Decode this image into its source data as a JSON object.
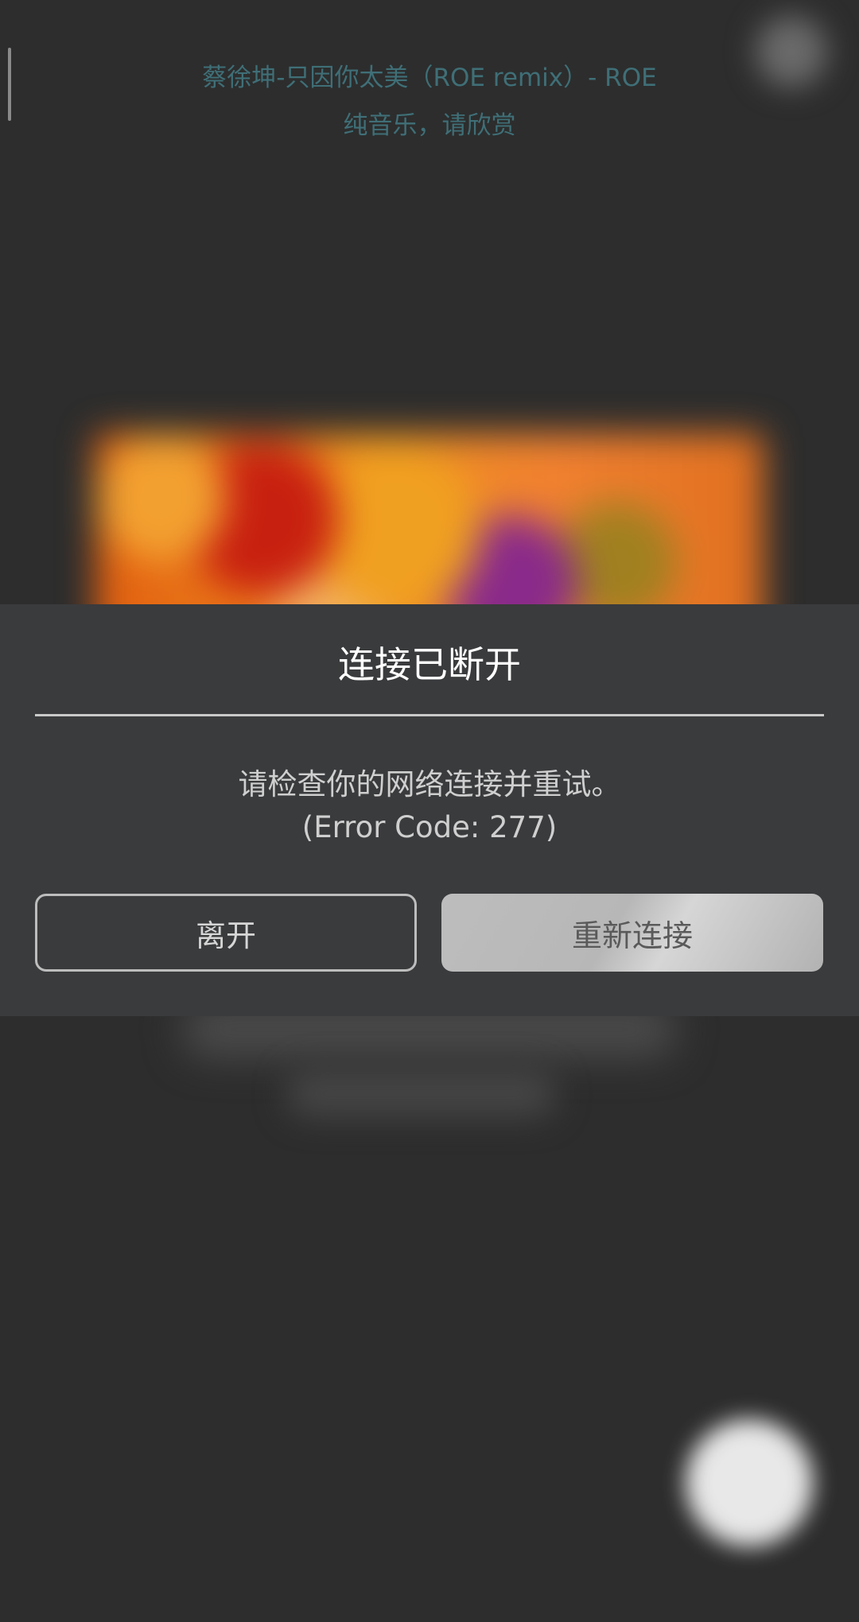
{
  "now_playing": {
    "title": "蔡徐坤-只因你太美（ROE remix）- ROE",
    "subtitle": "纯音乐，请欣赏"
  },
  "dialog": {
    "title": "连接已断开",
    "message_line1": "请检查你的网络连接并重试。",
    "message_line2": "(Error Code: 277)",
    "leave_label": "离开",
    "reconnect_label": "重新连接"
  },
  "colors": {
    "background": "#2d2d2d",
    "dialog_background": "#3a3b3d",
    "lyric_text": "#3f6f77",
    "title_text": "#ffffff",
    "message_text": "#cfcfcf"
  }
}
